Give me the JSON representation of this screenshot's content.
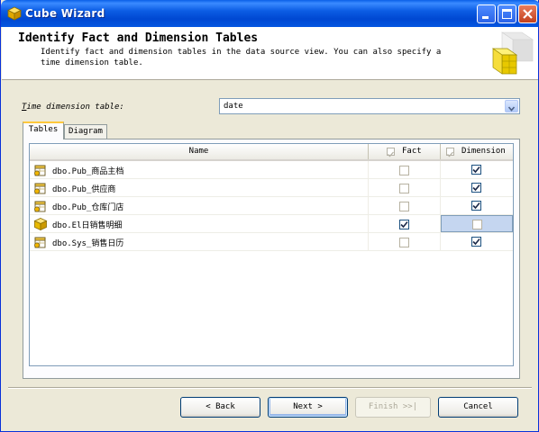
{
  "window": {
    "title": "Cube Wizard"
  },
  "header": {
    "title": "Identify Fact and Dimension Tables",
    "description": "Identify fact and dimension tables in the data source view. You can also specify a time dimension table."
  },
  "time_dimension": {
    "label_accel": "T",
    "label_rest": "ime dimension table:",
    "selected": "date"
  },
  "tabs": [
    {
      "label": "Tables",
      "active": true
    },
    {
      "label": "Diagram",
      "active": false
    }
  ],
  "grid": {
    "columns": {
      "name": "Name",
      "fact": "Fact",
      "dimension": "Dimension"
    },
    "rows": [
      {
        "name": "dbo.Pub_商品主档",
        "icon": "dimension-table-icon",
        "fact": false,
        "dimension": true
      },
      {
        "name": "dbo.Pub_供应商",
        "icon": "dimension-table-icon",
        "fact": false,
        "dimension": true
      },
      {
        "name": "dbo.Pub_仓库门店",
        "icon": "dimension-table-icon",
        "fact": false,
        "dimension": true
      },
      {
        "name": "dbo.El日销售明细",
        "icon": "fact-table-icon",
        "fact": true,
        "dimension": false
      },
      {
        "name": "dbo.Sys_销售日历",
        "icon": "dimension-table-icon",
        "fact": false,
        "dimension": true
      }
    ]
  },
  "buttons": {
    "back": "< Back",
    "next": "Next >",
    "finish": "Finish >>|",
    "cancel": "Cancel"
  }
}
